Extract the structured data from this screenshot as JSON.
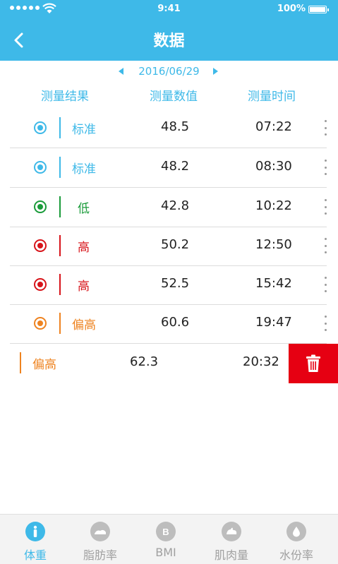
{
  "status_bar": {
    "time": "9:41",
    "battery": "100%"
  },
  "header": {
    "title": "数据"
  },
  "date_nav": {
    "date": "2016/06/29"
  },
  "columns": {
    "result": "测量结果",
    "value": "测量数值",
    "time": "测量时间"
  },
  "colors": {
    "standard": "#3eb9e8",
    "low": "#1a9b3a",
    "high": "#d7141a",
    "slightly_high": "#ee8320"
  },
  "records": [
    {
      "status": "标准",
      "value": "48.5",
      "time": "07:22",
      "color": "#3eb9e8"
    },
    {
      "status": "标准",
      "value": "48.2",
      "time": "08:30",
      "color": "#3eb9e8"
    },
    {
      "status": "低",
      "value": "42.8",
      "time": "10:22",
      "color": "#1a9b3a"
    },
    {
      "status": "高",
      "value": "50.2",
      "time": "12:50",
      "color": "#d7141a"
    },
    {
      "status": "高",
      "value": "52.5",
      "time": "15:42",
      "color": "#d7141a"
    },
    {
      "status": "偏高",
      "value": "60.6",
      "time": "19:47",
      "color": "#ee8320"
    }
  ],
  "swiped_record": {
    "status": "偏高",
    "value": "62.3",
    "time": "20:32",
    "color": "#ee8320"
  },
  "tabs": [
    {
      "label": "体重",
      "icon": "person-icon",
      "active": true
    },
    {
      "label": "脂肪率",
      "icon": "fat-icon",
      "active": false
    },
    {
      "label": "BMI",
      "icon": "bmi-icon",
      "icon_text": "B",
      "active": false
    },
    {
      "label": "肌肉量",
      "icon": "muscle-icon",
      "active": false
    },
    {
      "label": "水份率",
      "icon": "water-drop-icon",
      "active": false
    }
  ]
}
